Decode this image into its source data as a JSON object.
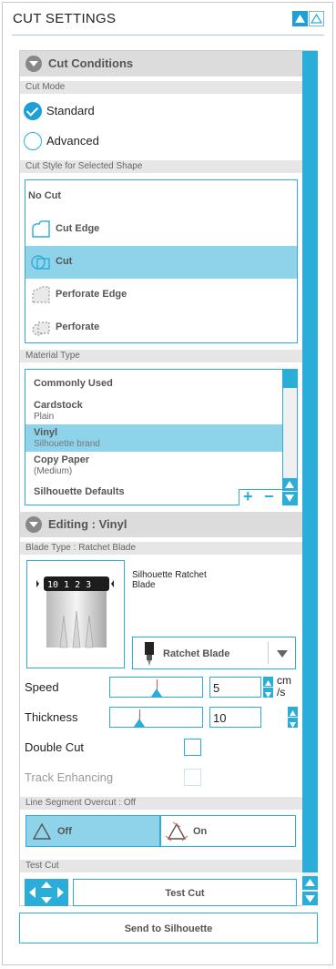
{
  "header": {
    "title": "CUT SETTINGS"
  },
  "cut_conditions": {
    "title": "Cut Conditions",
    "cut_mode": {
      "label": "Cut Mode",
      "options": [
        "Standard",
        "Advanced"
      ],
      "selected": "Standard"
    },
    "cut_style": {
      "label": "Cut Style for Selected Shape",
      "items": [
        "No Cut",
        "Cut Edge",
        "Cut",
        "Perforate Edge",
        "Perforate"
      ],
      "selected": "Cut"
    },
    "material": {
      "label": "Material Type",
      "items": [
        {
          "name": "Commonly Used",
          "sub": ""
        },
        {
          "name": "Cardstock",
          "sub": "Plain"
        },
        {
          "name": "Vinyl",
          "sub": "Silhouette brand"
        },
        {
          "name": "Copy Paper",
          "sub": "(Medium)"
        },
        {
          "name": "Silhouette Defaults",
          "sub": ""
        }
      ],
      "selected": "Vinyl",
      "add_label": "+",
      "remove_label": "−"
    }
  },
  "editing": {
    "title": "Editing : Vinyl",
    "blade": {
      "label": "Blade Type : Ratchet Blade",
      "name": "Silhouette  Ratchet Blade",
      "dial": "10 1 2 3",
      "selected": "Ratchet Blade"
    },
    "speed": {
      "label": "Speed",
      "value": "5",
      "unit": "cm\n/s",
      "level": 0.5
    },
    "thickness": {
      "label": "Thickness",
      "value": "10",
      "level": 0.32
    },
    "double_cut": {
      "label": "Double Cut",
      "checked": false
    },
    "track_enhancing": {
      "label": "Track Enhancing",
      "checked": false,
      "disabled": true
    },
    "line_overcut": {
      "label": "Line Segment Overcut : Off",
      "off_label": "Off",
      "on_label": "On",
      "selected": "Off"
    }
  },
  "test_cut": {
    "label": "Test Cut",
    "button_label": "Test Cut"
  },
  "send": {
    "label": "Send to Silhouette"
  },
  "colors": {
    "accent": "#2aaed9",
    "selected": "#8fd3ea",
    "section_bg": "#dcdcdc"
  }
}
